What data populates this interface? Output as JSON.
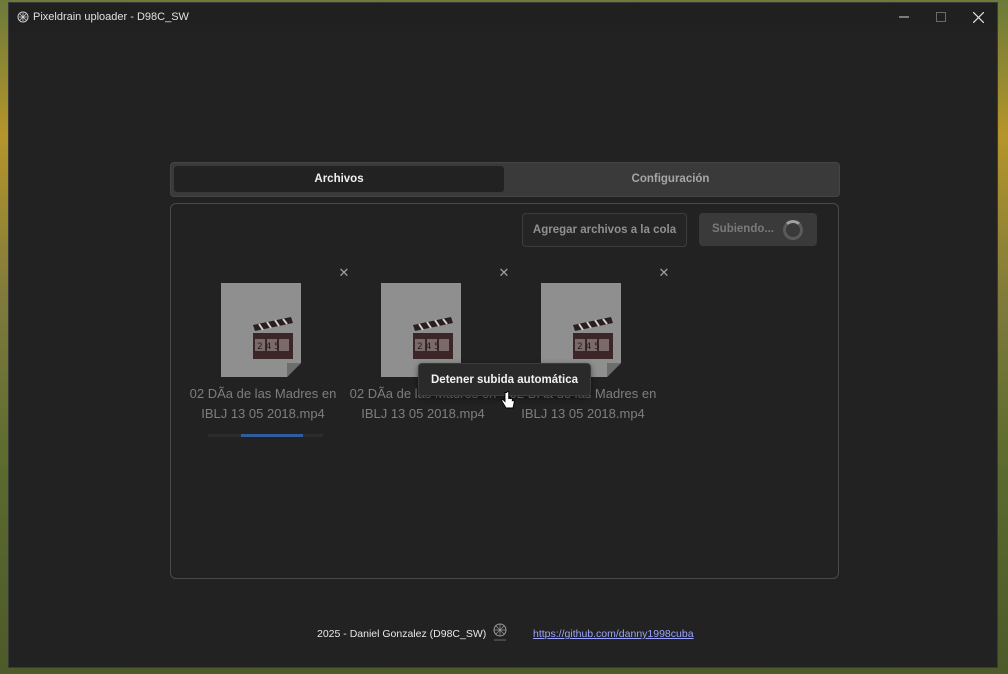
{
  "window": {
    "title": "Pixeldrain uploader - D98C_SW"
  },
  "tabs": [
    {
      "label": "Archivos",
      "active": true
    },
    {
      "label": "Configuración",
      "active": false
    }
  ],
  "toolbar": {
    "queue_label": "Agregar archivos a la cola",
    "upload_label": "Subiendo..."
  },
  "files": [
    {
      "name_line1": "02 DÃa de las Madres en",
      "name_line2": "IBLJ 13 05 2018.mp4",
      "progress": 0.55
    },
    {
      "name_line1": "02 DÃa de las Madres en",
      "name_line2": "IBLJ 13 05 2018.mp4"
    },
    {
      "name_line1": "02 DÃa de las Madres en",
      "name_line2": "IBLJ 13 05 2018.mp4"
    }
  ],
  "tooltip": {
    "text": "Detener subida automática"
  },
  "footer": {
    "credit": "2025 - Daniel Gonzalez (D98C_SW)",
    "link": "https://github.com/danny1998cuba"
  },
  "colors": {
    "accent": "#2e5f9c",
    "link": "#9aa4ff",
    "background": "#222222"
  }
}
